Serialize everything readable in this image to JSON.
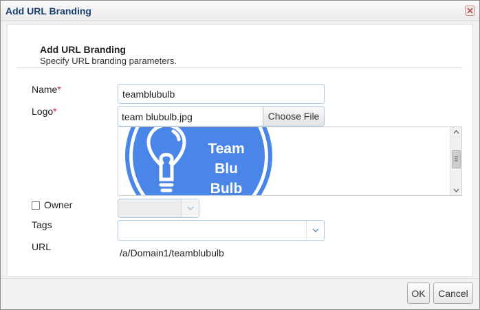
{
  "dialog": {
    "title": "Add URL Branding",
    "close_icon": "close-icon"
  },
  "section": {
    "title": "Add URL Branding",
    "subtitle": "Specify URL branding parameters."
  },
  "form": {
    "name_label": "Name",
    "name_value": "teamblubulb",
    "logo_label": "Logo",
    "logo_filename": "team blubulb.jpg",
    "choose_file_label": "Choose File",
    "logo_preview_text_1": "Team",
    "logo_preview_text_2": "Blu",
    "logo_preview_text_3": "Bulb",
    "logo_icon": "lightbulb-icon",
    "owner_label": "Owner",
    "owner_checked": false,
    "owner_value": "",
    "tags_label": "Tags",
    "tags_value": "",
    "url_label": "URL",
    "url_value": "/a/Domain1/teamblubulb",
    "required_marker": "*"
  },
  "footer": {
    "ok_label": "OK",
    "cancel_label": "Cancel"
  },
  "colors": {
    "title_text": "#1a3e6e",
    "required": "#c1272d",
    "logo_blue": "#4a86e8",
    "input_border": "#a8c7e3"
  }
}
